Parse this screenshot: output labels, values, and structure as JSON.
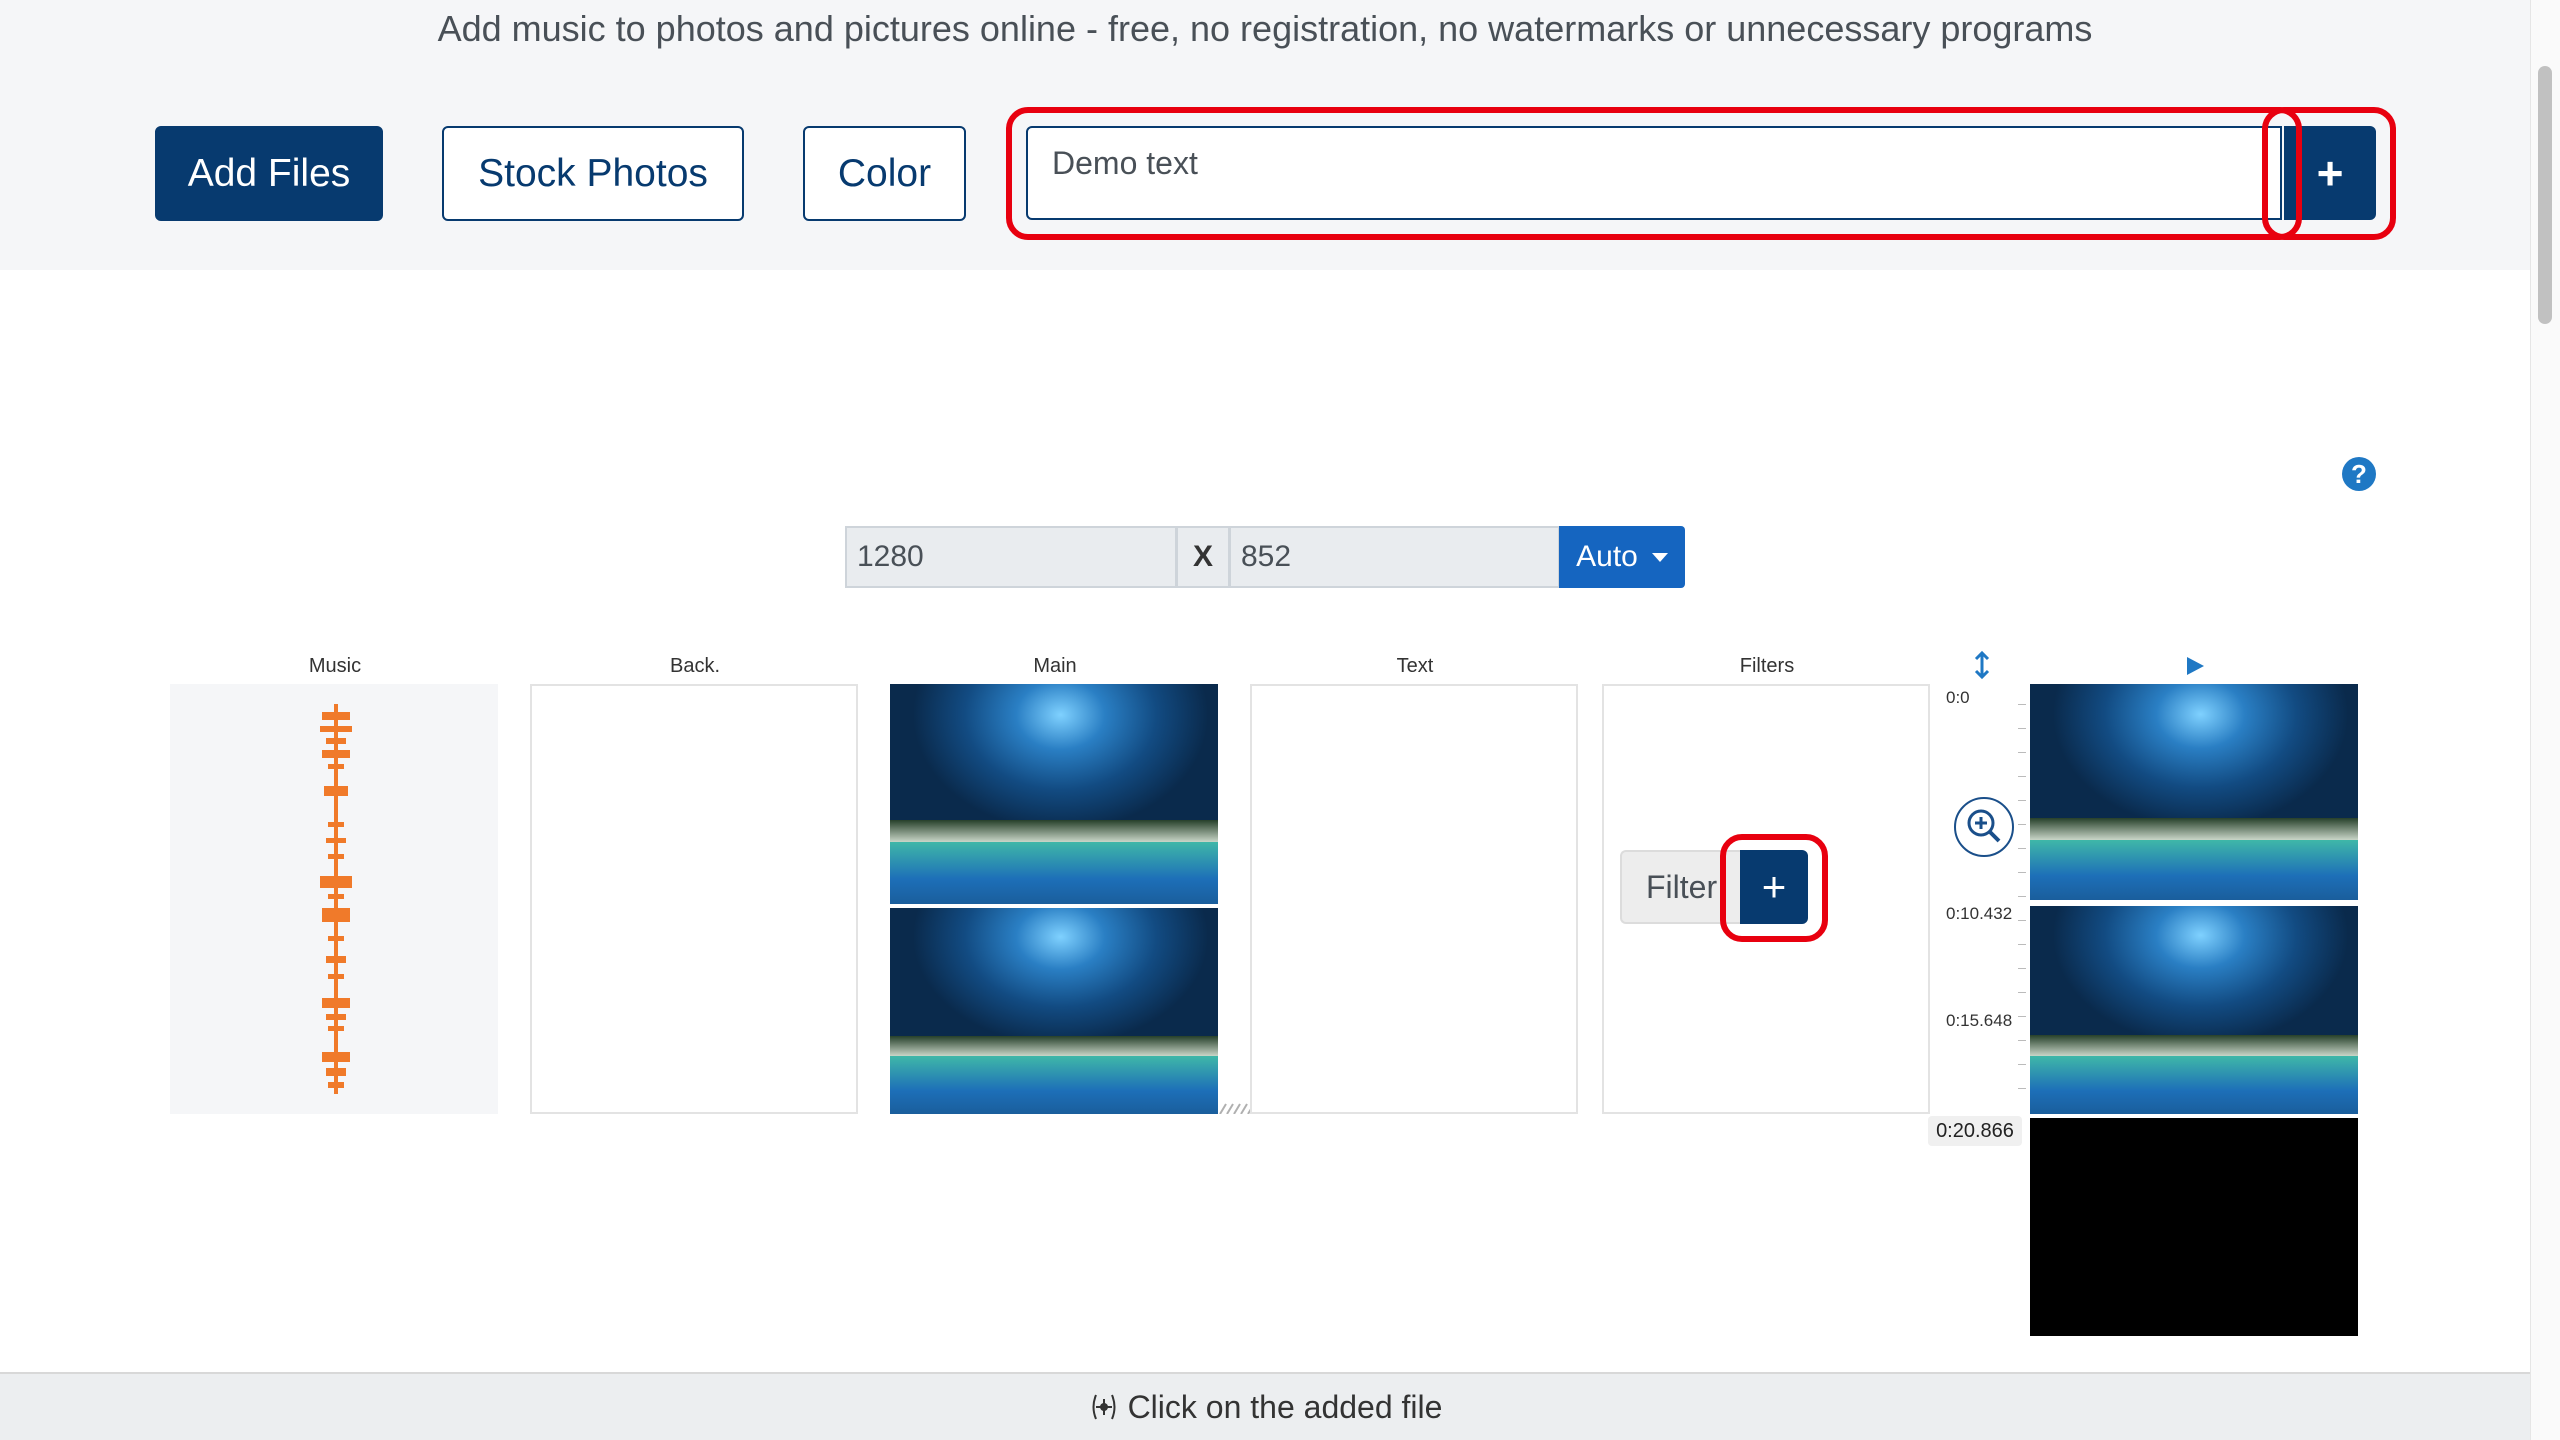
{
  "header": {
    "headline": "Add music to photos and pictures online - free, no registration, no watermarks or unnecessary programs",
    "add_files": "Add Files",
    "stock_photos": "Stock Photos",
    "color": "Color",
    "text_value": "Demo text",
    "add_text": "+"
  },
  "help": "?",
  "dimensions": {
    "width": "1280",
    "separator": "X",
    "height": "852",
    "mode": "Auto"
  },
  "columns": {
    "music": "Music",
    "back": "Back.",
    "main": "Main",
    "text": "Text",
    "filters": "Filters"
  },
  "filters": {
    "label": "Filter",
    "add": "+"
  },
  "timeline": {
    "marks": [
      "0:0",
      "0:10.432",
      "0:15.648"
    ],
    "total": "0:20.866"
  },
  "footer": {
    "hint": "Click on the added file"
  },
  "colors": {
    "primary": "#073a6f",
    "accent": "#1565c0",
    "highlight": "#e8000f",
    "waveform": "#f07a2a"
  }
}
